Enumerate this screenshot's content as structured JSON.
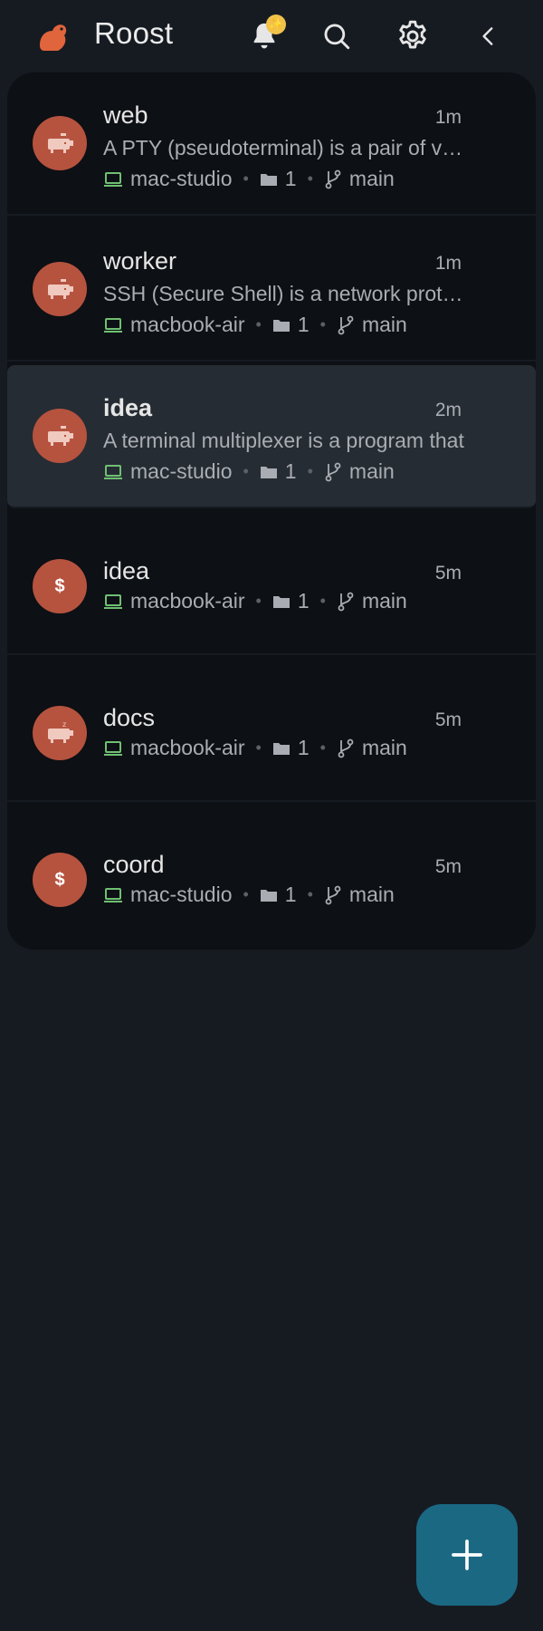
{
  "app": {
    "title": "Roost",
    "notification_badge": "✨"
  },
  "sessions": [
    {
      "name": "web",
      "time": "1m",
      "preview": "A PTY (pseudoterminal) is a pair of virtual devices",
      "host": "mac-studio",
      "folders": "1",
      "branch": "main",
      "avatar": "pig-icon"
    },
    {
      "name": "worker",
      "time": "1m",
      "preview": "SSH (Secure Shell) is a network protocol",
      "host": "macbook-air",
      "folders": "1",
      "branch": "main",
      "avatar": "pig-icon"
    },
    {
      "name": "idea",
      "time": "2m",
      "preview": "A terminal multiplexer is a program that",
      "host": "mac-studio",
      "folders": "1",
      "branch": "main",
      "avatar": "pig-icon",
      "selected": true
    },
    {
      "name": "idea",
      "time": "5m",
      "host": "macbook-air",
      "folders": "1",
      "branch": "main",
      "avatar": "dollar-icon",
      "avatar_text": "$"
    },
    {
      "name": "docs",
      "time": "5m",
      "host": "macbook-air",
      "folders": "1",
      "branch": "main",
      "avatar": "sleeping-pig-icon"
    },
    {
      "name": "coord",
      "time": "5m",
      "host": "mac-studio",
      "folders": "1",
      "branch": "main",
      "avatar": "dollar-icon",
      "avatar_text": "$"
    }
  ],
  "colors": {
    "accent": "#1b6883",
    "avatar": "#b5533f",
    "host_icon": "#6fbf73",
    "badge": "#f2c14a"
  }
}
